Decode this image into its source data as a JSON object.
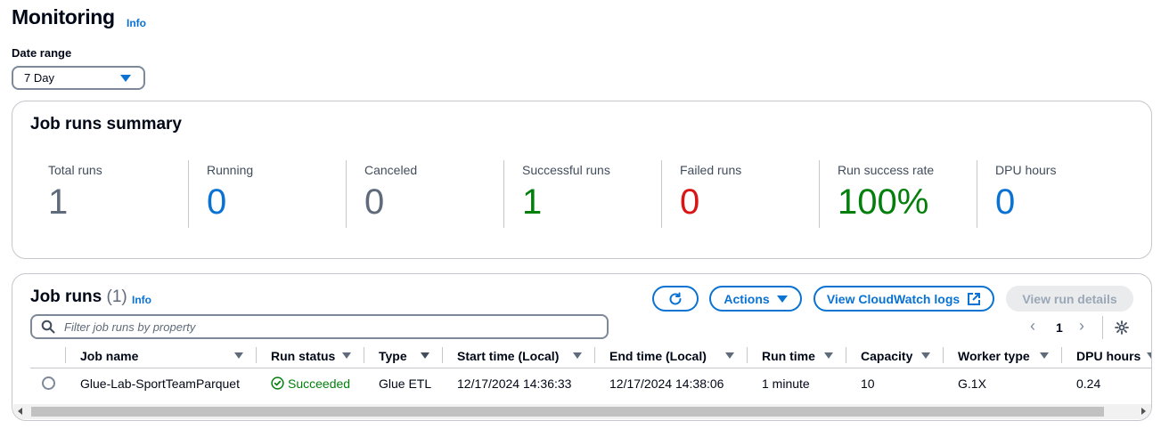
{
  "header": {
    "title": "Monitoring",
    "info": "Info"
  },
  "date_range": {
    "label": "Date range",
    "value": "7 Day"
  },
  "summary": {
    "title": "Job runs summary",
    "metrics": [
      {
        "label": "Total runs",
        "value": "1",
        "color": "#5f6b7a"
      },
      {
        "label": "Running",
        "value": "0",
        "color": "#0972d3"
      },
      {
        "label": "Canceled",
        "value": "0",
        "color": "#5f6b7a"
      },
      {
        "label": "Successful runs",
        "value": "1",
        "color": "#037f0c"
      },
      {
        "label": "Failed runs",
        "value": "0",
        "color": "#d91515"
      },
      {
        "label": "Run success rate",
        "value": "100%",
        "color": "#037f0c"
      },
      {
        "label": "DPU hours",
        "value": "0",
        "color": "#0972d3"
      }
    ]
  },
  "job_runs": {
    "title": "Job runs",
    "count": "(1)",
    "info": "Info",
    "actions_label": "Actions",
    "cloudwatch_label": "View CloudWatch logs",
    "details_label": "View run details",
    "search_placeholder": "Filter job runs by property",
    "page": "1",
    "columns": [
      "Job name",
      "Run status",
      "Type",
      "Start time (Local)",
      "End time (Local)",
      "Run time",
      "Capacity",
      "Worker type",
      "DPU hours"
    ],
    "rows": [
      {
        "job_name": "Glue-Lab-SportTeamParquet",
        "run_status": "Succeeded",
        "type": "Glue ETL",
        "start_time": "12/17/2024 14:36:33",
        "end_time": "12/17/2024 14:38:06",
        "run_time": "1 minute",
        "capacity": "10",
        "worker_type": "G.1X",
        "dpu_hours": "0.24"
      }
    ]
  }
}
